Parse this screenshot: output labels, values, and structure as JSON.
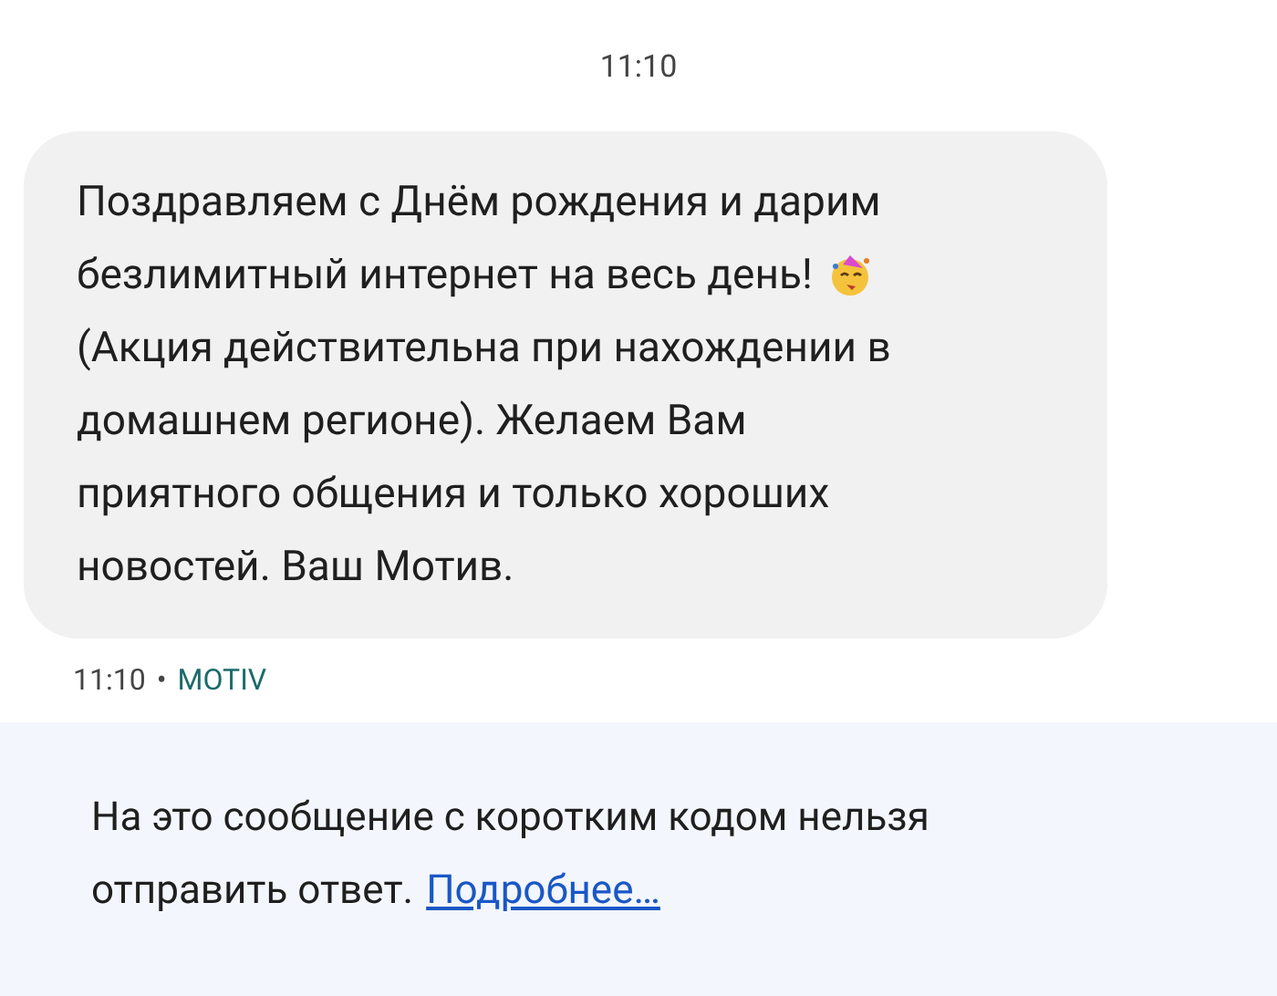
{
  "header_time": "11:10",
  "message": {
    "lines": [
      {
        "text": "Поздравляем с Днём рождения и дарим",
        "emoji": false
      },
      {
        "text": "безлимитный интернет на весь день!",
        "emoji": true
      },
      {
        "text": "(Акция действительна при нахождении в",
        "emoji": false
      },
      {
        "text": "домашнем регионе). Желаем Вам",
        "emoji": false
      },
      {
        "text": "приятного общения и только хороших",
        "emoji": false
      },
      {
        "text": "новостей. Ваш Мотив.",
        "emoji": false
      }
    ],
    "time": "11:10",
    "separator": "•",
    "sender": "MOTIV"
  },
  "notice": {
    "line_1": "На это сообщение с коротким кодом нельзя",
    "line_2": "отправить ответ.",
    "link": "Подробнее…"
  }
}
